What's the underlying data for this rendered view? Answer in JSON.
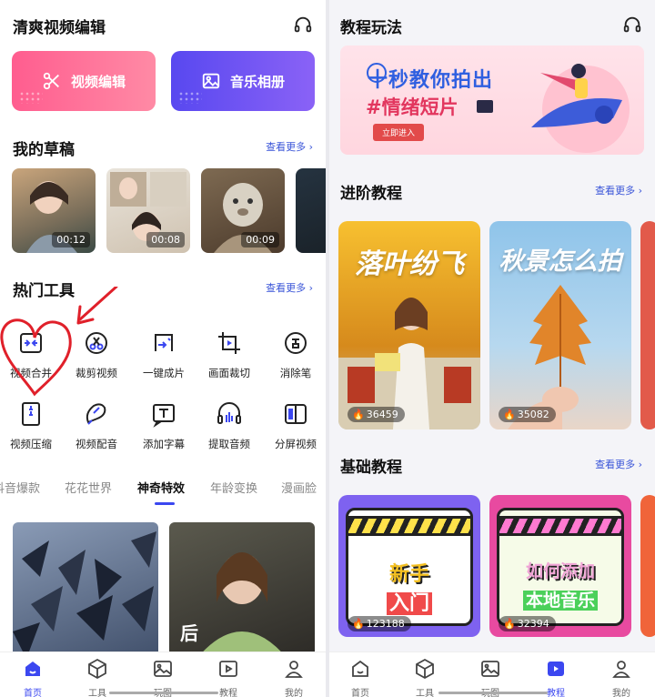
{
  "left_screen": {
    "title": "清爽视频编辑",
    "hero_buttons": [
      {
        "label": "视频编辑",
        "icon": "scissors-icon",
        "color": "#ff6b98"
      },
      {
        "label": "音乐相册",
        "icon": "photo-icon",
        "color": "#6a4df2"
      }
    ],
    "drafts": {
      "title": "我的草稿",
      "more": "查看更多 ›",
      "items": [
        {
          "duration": "00:12"
        },
        {
          "duration": "00:08"
        },
        {
          "duration": "00:09"
        }
      ]
    },
    "hot_tools": {
      "title": "热门工具",
      "more": "查看更多 ›",
      "items": [
        {
          "label": "视频合并",
          "icon": "merge-icon"
        },
        {
          "label": "裁剪视频",
          "icon": "cut-icon"
        },
        {
          "label": "一键成片",
          "icon": "auto-film-icon"
        },
        {
          "label": "画面裁切",
          "icon": "crop-icon"
        },
        {
          "label": "消除笔",
          "icon": "eraser-icon"
        },
        {
          "label": "视频压缩",
          "icon": "compress-icon"
        },
        {
          "label": "视频配音",
          "icon": "dub-icon"
        },
        {
          "label": "添加字幕",
          "icon": "subtitle-icon"
        },
        {
          "label": "提取音频",
          "icon": "extract-audio-icon"
        },
        {
          "label": "分屏视频",
          "icon": "split-screen-icon"
        }
      ]
    },
    "category_tabs": [
      "抖音爆款",
      "花花世界",
      "神奇特效",
      "年龄变换",
      "漫画脸"
    ],
    "active_category": "神奇特效",
    "effect_card_text": "后",
    "nav": [
      {
        "label": "首页",
        "icon": "home-icon",
        "active": true
      },
      {
        "label": "工具",
        "icon": "tools-icon",
        "active": false
      },
      {
        "label": "玩图",
        "icon": "image-icon",
        "active": false
      },
      {
        "label": "教程",
        "icon": "tutorial-icon",
        "active": false
      },
      {
        "label": "我的",
        "icon": "profile-icon",
        "active": false
      }
    ]
  },
  "right_screen": {
    "title": "教程玩法",
    "banner": {
      "line1": "十秒教你拍出",
      "line2": "#情绪短片",
      "button": "立即进入"
    },
    "advanced": {
      "title": "进阶教程",
      "more": "查看更多 ›",
      "items": [
        {
          "title": "落叶纷飞",
          "views": "36459"
        },
        {
          "title": "秋景怎么拍",
          "views": "35082"
        }
      ]
    },
    "basic": {
      "title": "基础教程",
      "more": "查看更多 ›",
      "items": [
        {
          "line1": "新手",
          "line2": "入门",
          "views": "123188"
        },
        {
          "line1": "如何添加",
          "line2": "本地音乐",
          "views": "32394"
        }
      ]
    },
    "nav": [
      {
        "label": "首页",
        "icon": "home-icon",
        "active": false
      },
      {
        "label": "工具",
        "icon": "tools-icon",
        "active": false
      },
      {
        "label": "玩图",
        "icon": "image-icon",
        "active": false
      },
      {
        "label": "教程",
        "icon": "tutorial-icon",
        "active": true
      },
      {
        "label": "我的",
        "icon": "profile-icon",
        "active": false
      }
    ]
  },
  "annotation": {
    "color": "#e0202a"
  }
}
